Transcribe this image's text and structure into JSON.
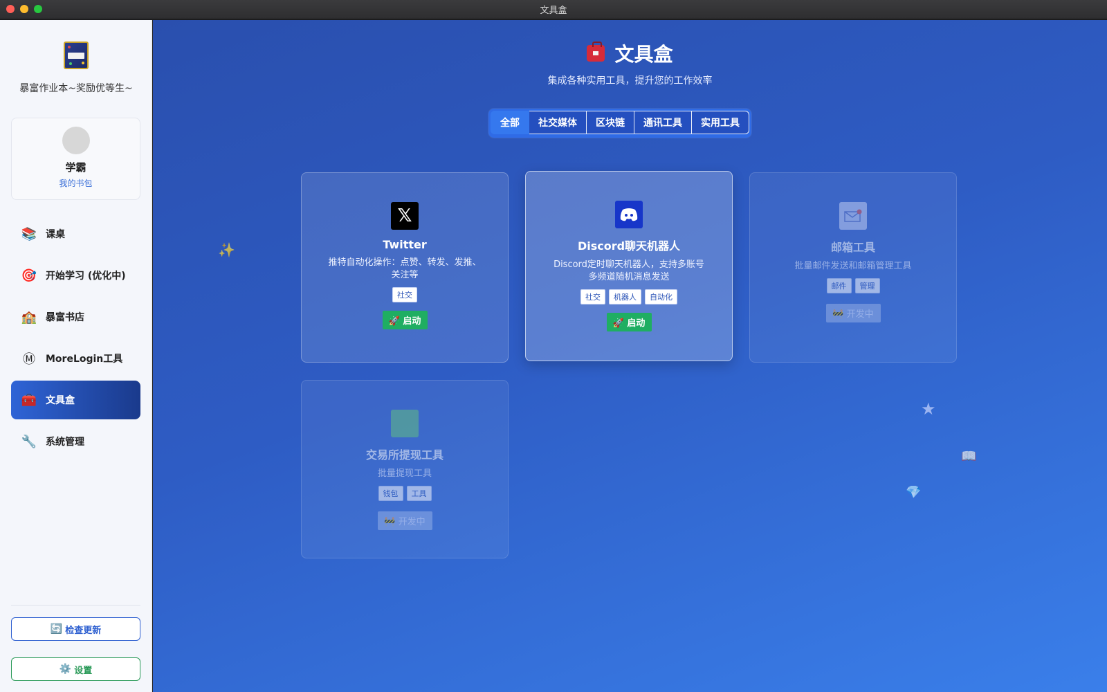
{
  "window": {
    "title": "文具盒"
  },
  "sidebar": {
    "brand": "暴富作业本~奖励优等生~",
    "profile": {
      "name": "学霸",
      "link": "我的书包"
    },
    "nav": [
      {
        "label": "课桌",
        "icon": "books-icon"
      },
      {
        "label": "开始学习 (优化中)",
        "icon": "target-icon"
      },
      {
        "label": "暴富书店",
        "icon": "school-icon"
      },
      {
        "label": "MoreLogin工具",
        "icon": "morelogin-icon"
      },
      {
        "label": "文具盒",
        "icon": "toolbox-icon",
        "active": true
      },
      {
        "label": "系统管理",
        "icon": "wrench-icon"
      }
    ],
    "update_button": "检查更新",
    "settings_button": "设置"
  },
  "main": {
    "title": "文具盒",
    "subtitle": "集成各种实用工具，提升您的工作效率",
    "tabs": [
      "全部",
      "社交媒体",
      "区块链",
      "通讯工具",
      "实用工具"
    ],
    "active_tab": "全部",
    "cards": [
      {
        "name": "Twitter",
        "desc": "推特自动化操作：点赞、转发、发推、关注等",
        "tags": [
          "社交"
        ],
        "button": "🚀 启动",
        "status": "active"
      },
      {
        "name": "Discord聊天机器人",
        "desc": "Discord定时聊天机器人，支持多账号多频道随机消息发送",
        "tags": [
          "社交",
          "机器人",
          "自动化"
        ],
        "button": "🚀 启动",
        "status": "active"
      },
      {
        "name": "邮箱工具",
        "desc": "批量邮件发送和邮箱管理工具",
        "tags": [
          "邮件",
          "管理"
        ],
        "button": "🚧 开发中",
        "status": "developing"
      },
      {
        "name": "交易所提现工具",
        "desc": "批量提现工具",
        "tags": [
          "钱包",
          "工具"
        ],
        "button": "🚧 开发中",
        "status": "developing"
      }
    ]
  },
  "colors": {
    "accent": "#2f64d6",
    "launch": "#1fae62",
    "settings": "#2a9a58"
  }
}
